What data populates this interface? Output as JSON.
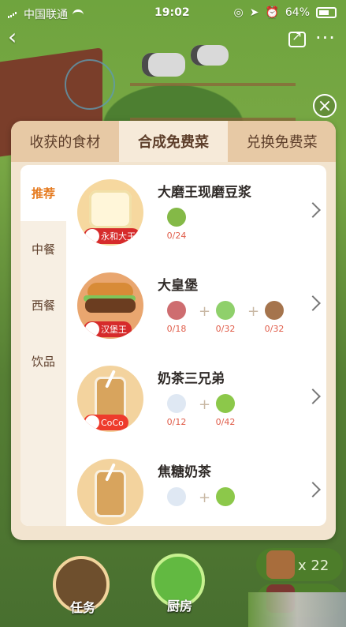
{
  "status_bar": {
    "carrier": "中国联通",
    "time": "19:02",
    "battery": "64%"
  },
  "tabs": [
    {
      "label": "收获的食材"
    },
    {
      "label": "合成免费菜"
    },
    {
      "label": "兑换免费菜"
    }
  ],
  "categories": [
    "推荐",
    "中餐",
    "西餐",
    "饮品"
  ],
  "recipes": [
    {
      "name": "大磨王现磨豆浆",
      "brand": "永和大王",
      "ingredients": [
        {
          "count": "0/24"
        }
      ]
    },
    {
      "name": "大皇堡",
      "brand": "汉堡王",
      "ingredients": [
        {
          "count": "0/18"
        },
        {
          "count": "0/32"
        },
        {
          "count": "0/32"
        }
      ]
    },
    {
      "name": "奶茶三兄弟",
      "brand": "CoCo",
      "ingredients": [
        {
          "count": "0/12"
        },
        {
          "count": "0/42"
        }
      ]
    },
    {
      "name": "焦糖奶茶",
      "brand": "",
      "ingredients": []
    }
  ],
  "bottom_nav": {
    "task": "任务",
    "kitchen": "厨房",
    "bag_count": "x 22"
  }
}
